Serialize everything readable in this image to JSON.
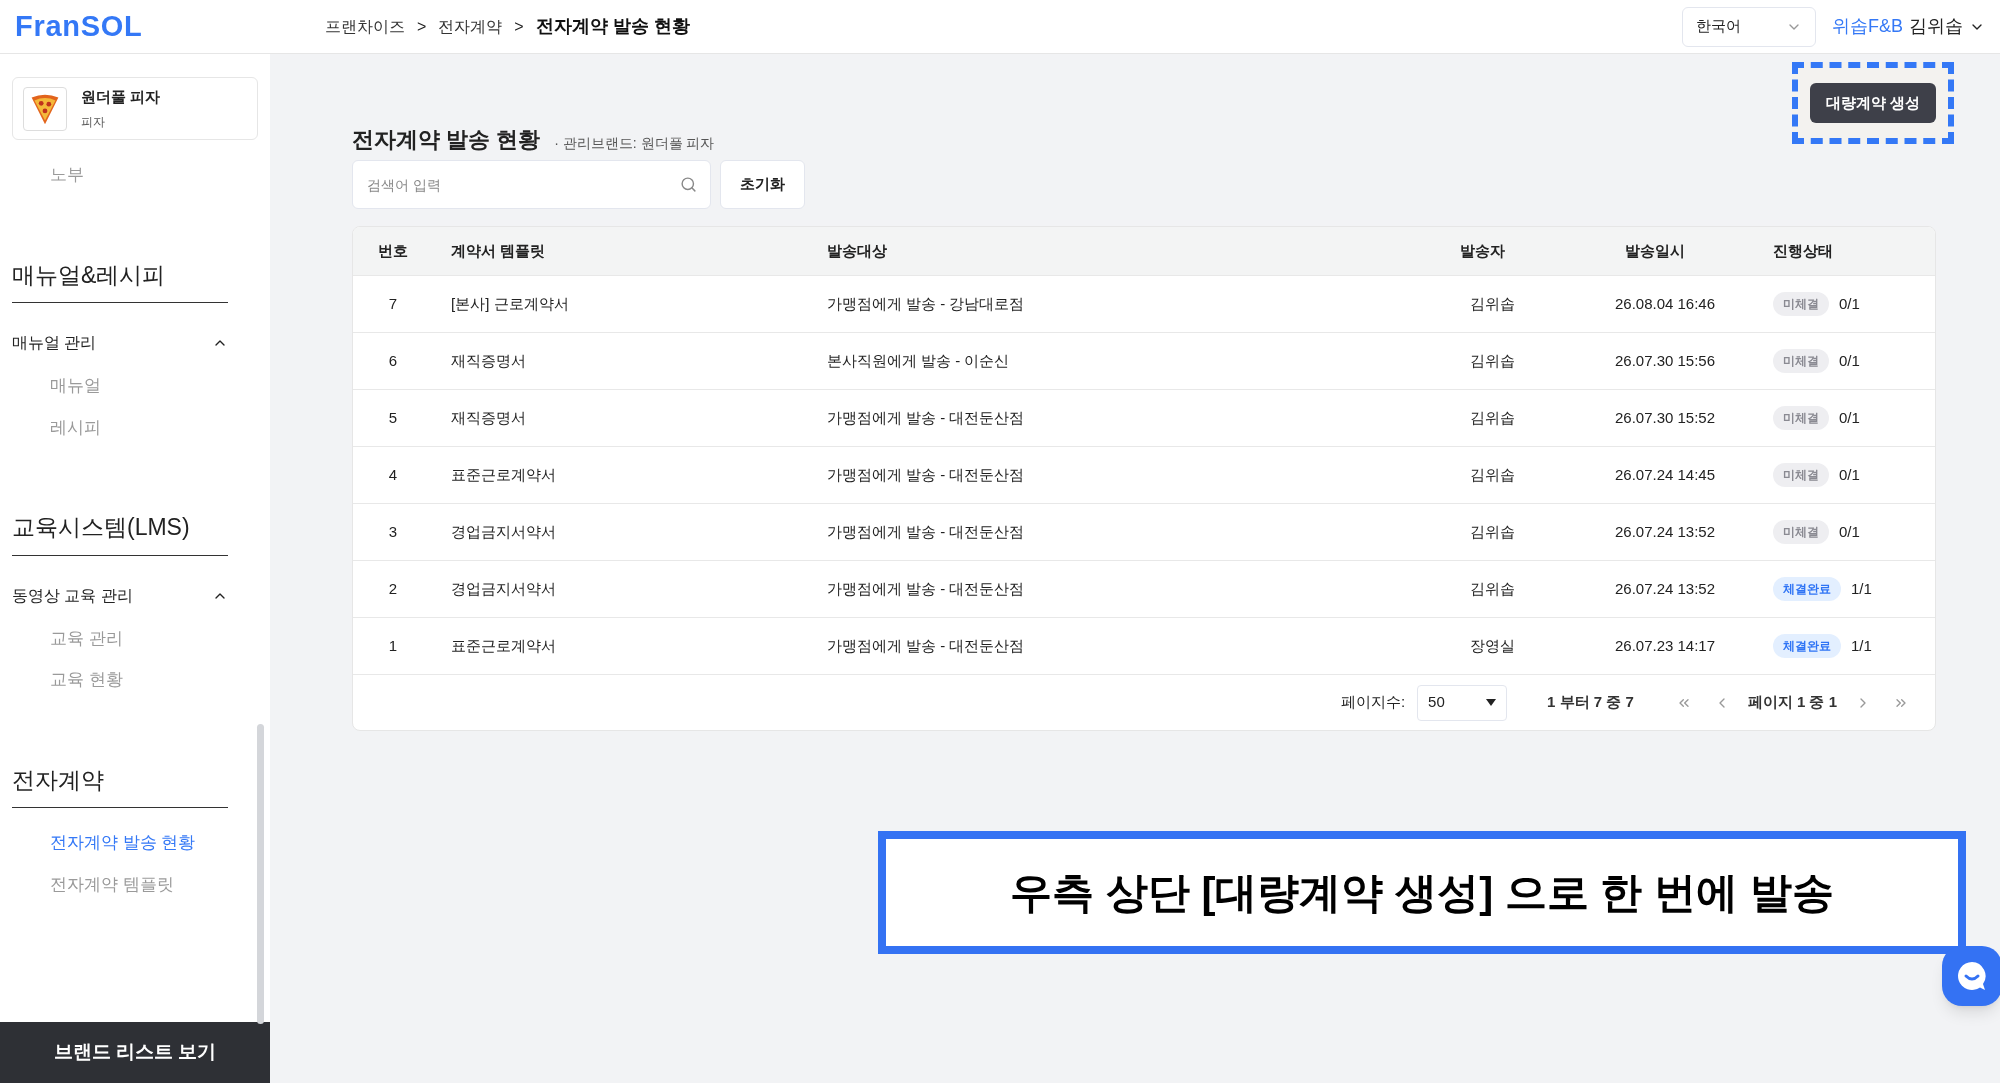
{
  "header": {
    "logo": "FranSOL",
    "breadcrumbs": [
      {
        "label": "프랜차이즈",
        "current": false
      },
      {
        "label": "전자계약",
        "current": false
      },
      {
        "label": "전자계약 발송 현황",
        "current": true
      }
    ],
    "separator": ">",
    "language": "한국어",
    "company": "위솝F&B",
    "user": "김위솝"
  },
  "sidebar": {
    "brand": {
      "name": "원더풀 피자",
      "category": "피자"
    },
    "top_items": [
      {
        "label": "노부",
        "selected": false
      }
    ],
    "sections": [
      {
        "title": "매뉴얼&레시피",
        "groups": [
          {
            "label": "매뉴얼 관리",
            "expanded": true,
            "items": [
              {
                "label": "매뉴얼",
                "selected": false
              },
              {
                "label": "레시피",
                "selected": false
              }
            ]
          }
        ]
      },
      {
        "title": "교육시스템(LMS)",
        "groups": [
          {
            "label": "동영상 교육 관리",
            "expanded": true,
            "items": [
              {
                "label": "교육 관리",
                "selected": false
              },
              {
                "label": "교육 현황",
                "selected": false
              }
            ]
          }
        ]
      },
      {
        "title": "전자계약",
        "items": [
          {
            "label": "전자계약 발송 현황",
            "selected": true
          },
          {
            "label": "전자계약 템플릿",
            "selected": false
          }
        ]
      }
    ],
    "footer_button": "브랜드 리스트 보기"
  },
  "page": {
    "title": "전자계약 발송 현황",
    "subtitle": "· 관리브랜드: 원더풀 피자",
    "bulk_button": "대량계약 생성",
    "search": {
      "placeholder": "검색어 입력"
    },
    "reset_button": "초기화"
  },
  "table": {
    "columns": [
      "번호",
      "계약서 템플릿",
      "발송대상",
      "발송자",
      "발송일시",
      "진행상태"
    ],
    "rows": [
      {
        "no": "7",
        "template": "[본사] 근로계약서",
        "target": "가맹점에게 발송 - 강남대로점",
        "sender": "김위솝",
        "sent_at": "26.08.04 16:46",
        "status": {
          "kind": "pending",
          "label": "미체결",
          "count": "0/1"
        }
      },
      {
        "no": "6",
        "template": "재직증명서",
        "target": "본사직원에게 발송 - 이순신",
        "sender": "김위솝",
        "sent_at": "26.07.30 15:56",
        "status": {
          "kind": "pending",
          "label": "미체결",
          "count": "0/1"
        }
      },
      {
        "no": "5",
        "template": "재직증명서",
        "target": "가맹점에게 발송 - 대전둔산점",
        "sender": "김위솝",
        "sent_at": "26.07.30 15:52",
        "status": {
          "kind": "pending",
          "label": "미체결",
          "count": "0/1"
        }
      },
      {
        "no": "4",
        "template": "표준근로계약서",
        "target": "가맹점에게 발송 - 대전둔산점",
        "sender": "김위솝",
        "sent_at": "26.07.24 14:45",
        "status": {
          "kind": "pending",
          "label": "미체결",
          "count": "0/1"
        }
      },
      {
        "no": "3",
        "template": "경업금지서약서",
        "target": "가맹점에게 발송 - 대전둔산점",
        "sender": "김위솝",
        "sent_at": "26.07.24 13:52",
        "status": {
          "kind": "pending",
          "label": "미체결",
          "count": "0/1"
        }
      },
      {
        "no": "2",
        "template": "경업금지서약서",
        "target": "가맹점에게 발송 - 대전둔산점",
        "sender": "김위솝",
        "sent_at": "26.07.24 13:52",
        "status": {
          "kind": "done",
          "label": "체결완료",
          "count": "1/1"
        }
      },
      {
        "no": "1",
        "template": "표준근로계약서",
        "target": "가맹점에게 발송 - 대전둔산점",
        "sender": "장영실",
        "sent_at": "26.07.23 14:17",
        "status": {
          "kind": "done",
          "label": "체결완료",
          "count": "1/1"
        }
      }
    ],
    "pagination": {
      "page_size_label": "페이지수:",
      "page_size": "50",
      "range": "1 부터 7 중 7",
      "page": "페이지 1 중 1"
    }
  },
  "annotation": "우측 상단 [대량계약 생성] 으로 한 번에 발송"
}
